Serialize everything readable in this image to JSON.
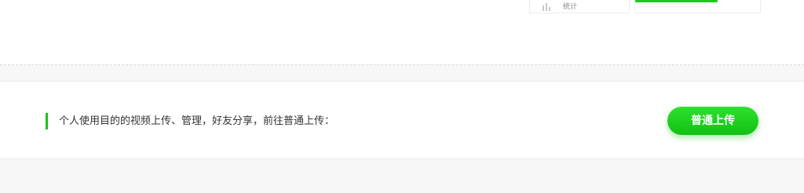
{
  "stats_card": {
    "icon": "bar-chart-icon",
    "label": "统计"
  },
  "upload_section": {
    "description": "个人使用目的的视频上传、管理，好友分享，前往普通上传：",
    "button_label": "普通上传"
  },
  "colors": {
    "accent": "#1bc21b",
    "button_top": "#2ee02e",
    "button_bottom": "#12c112",
    "background": "#f7f7f7"
  }
}
